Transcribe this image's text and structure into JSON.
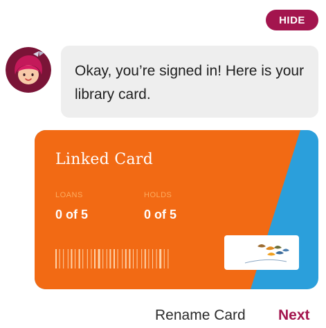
{
  "colors": {
    "accent": "#a3154e",
    "card_orange": "#f26a14",
    "card_blue": "#2b9fdb",
    "bubble_bg": "#eeeeee"
  },
  "header": {
    "hide_label": "HIDE"
  },
  "chat": {
    "avatar_icon": "librarian-avatar-icon",
    "message": "Okay, you’re signed in! Here is your library card."
  },
  "card": {
    "title": "Linked Card",
    "stats": [
      {
        "label": "LOANS",
        "value": "0 of 5"
      },
      {
        "label": "HOLDS",
        "value": "0 of 5"
      }
    ],
    "barcode_icon": "barcode-icon",
    "library_logo_icon": "library-birds-logo-icon"
  },
  "actions": {
    "rename_label": "Rename Card",
    "next_label": "Next"
  }
}
